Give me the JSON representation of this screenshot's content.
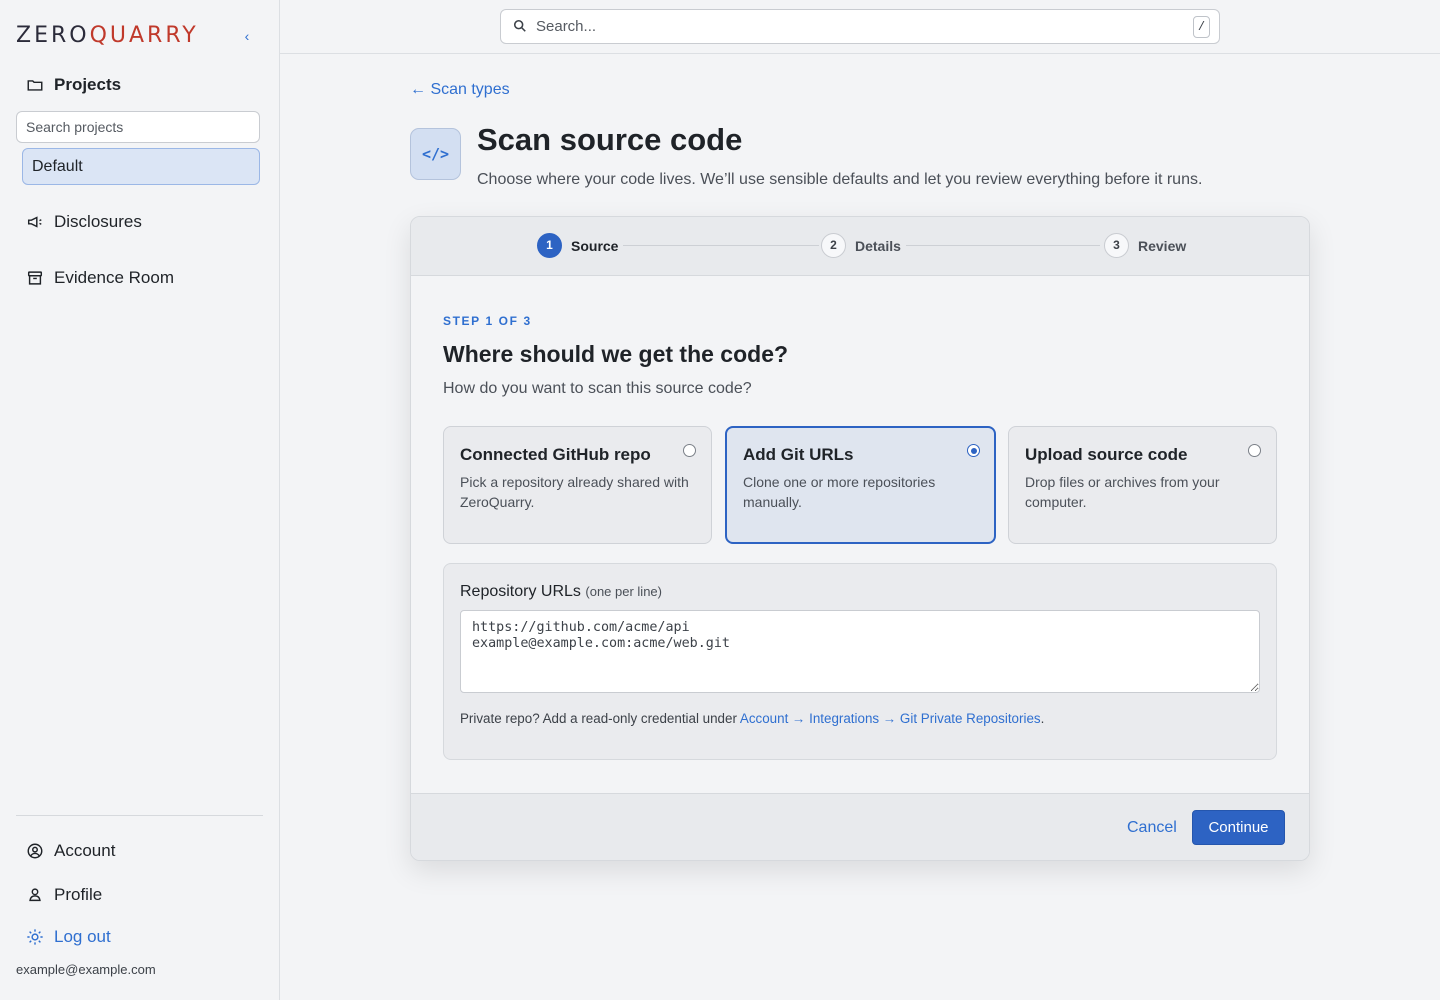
{
  "brand": {
    "logo_text_a": "ZERO",
    "logo_text_b": "QUARRY",
    "accent": "#2d63c3",
    "logo_q_color": "#c0392b"
  },
  "sidebar": {
    "collapse_label": "‹",
    "projects_label": "Projects",
    "project_search_placeholder": "Search projects",
    "projects": [
      {
        "label": "Default",
        "selected": true
      }
    ],
    "nav": [
      {
        "label": "Disclosures",
        "icon": "megaphone-icon"
      },
      {
        "label": "Evidence Room",
        "icon": "archive-box-icon"
      }
    ],
    "bottom_nav": [
      {
        "label": "Account",
        "icon": "user-circle-icon"
      },
      {
        "label": "Profile",
        "icon": "user-icon"
      },
      {
        "label": "Log out",
        "icon": "sun-icon"
      }
    ],
    "user_email": "example@example.com"
  },
  "topbar": {
    "search_placeholder": "Search...",
    "shortcut_key": "/"
  },
  "page": {
    "back_link": "← Scan types",
    "icon_glyph": "</>",
    "title": "Scan source code",
    "subtitle": "Choose where your code lives. We’ll use sensible defaults and let you review everything before it runs."
  },
  "stepper": {
    "steps": [
      {
        "number": "1",
        "label": "Source",
        "active": true
      },
      {
        "number": "2",
        "label": "Details",
        "active": false
      },
      {
        "number": "3",
        "label": "Review",
        "active": false
      }
    ]
  },
  "step": {
    "kicker": "STEP 1 OF 3",
    "title": "Where should we get the code?",
    "question": "How do you want to scan this source code?",
    "options": [
      {
        "title": "Connected GitHub repo",
        "description": "Pick a repository already shared with ZeroQuarry.",
        "selected": false
      },
      {
        "title": "Add Git URLs",
        "description": "Clone one or more repositories manually.",
        "selected": true
      },
      {
        "title": "Upload source code",
        "description": "Drop files or archives from your computer.",
        "selected": false
      }
    ]
  },
  "repo_urls": {
    "label": "Repository URLs",
    "hint": "(one per line)",
    "placeholder": "https://github.com/acme/api\nexample@example.com:acme/web.git",
    "note_prefix": "Private repo? Add a read-only credential under ",
    "note_link": "Account → Integrations → Git Private Repositories",
    "note_suffix": "."
  },
  "footer": {
    "cancel_label": "Cancel",
    "continue_label": "Continue"
  }
}
